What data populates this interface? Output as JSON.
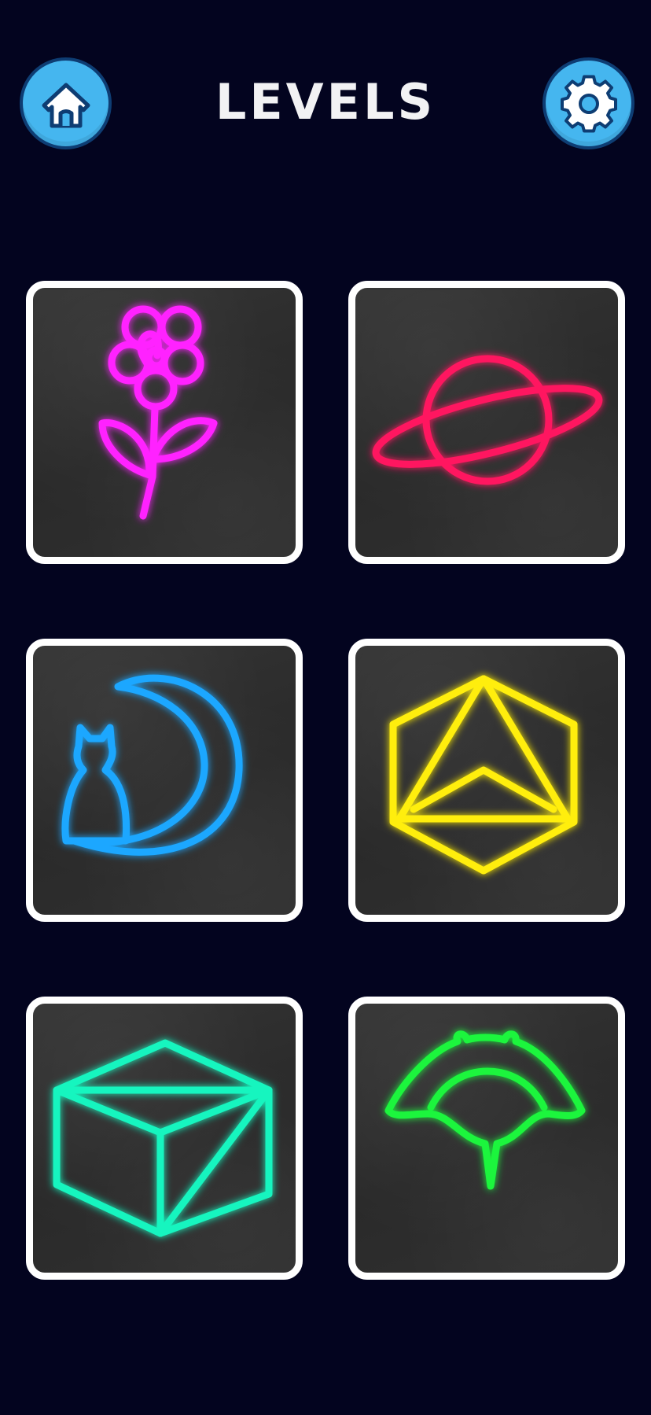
{
  "header": {
    "title": "LEVELS",
    "home_icon": "home-icon",
    "settings_icon": "gear-icon",
    "button_color": "#45b6ef"
  },
  "levels": [
    {
      "icon": "flower-icon",
      "color": "#ff22ff"
    },
    {
      "icon": "planet-icon",
      "color": "#ff1760"
    },
    {
      "icon": "cat-moon-icon",
      "color": "#1ba7ff"
    },
    {
      "icon": "polyhedron-icon",
      "color": "#ffee10"
    },
    {
      "icon": "cube-icon",
      "color": "#19f5bf"
    },
    {
      "icon": "stingray-icon",
      "color": "#1af53c"
    }
  ]
}
